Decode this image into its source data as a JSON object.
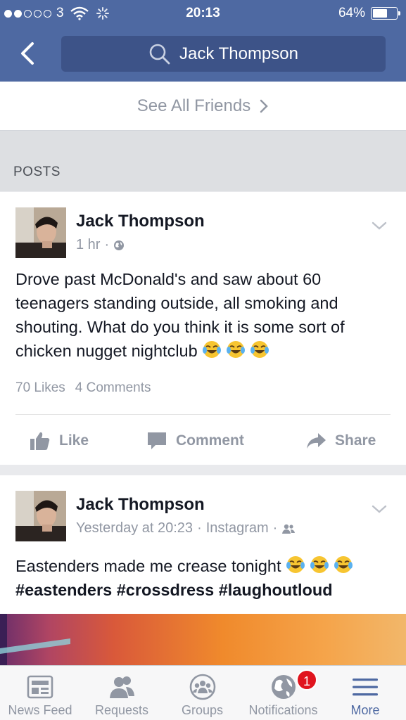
{
  "status_bar": {
    "carrier": "3",
    "time": "20:13",
    "battery": "64%",
    "battery_level": 0.64
  },
  "header": {
    "back_icon": "chevron-left-icon",
    "search_icon": "search-icon",
    "search_text": "Jack Thompson"
  },
  "friends": {
    "see_all_label": "See All Friends"
  },
  "posts_section": {
    "title": "POSTS"
  },
  "posts": [
    {
      "author": "Jack Thompson",
      "time": "1 hr",
      "audience_icon": "globe-icon",
      "text": "Drove past McDonald's and saw about 60 teenagers standing outside, all smoking and shouting. What do you think it is some sort of chicken nugget nightclub",
      "emojis": [
        "tears-of-joy-icon",
        "tears-of-joy-icon",
        "tears-of-joy-icon"
      ],
      "likes": "70 Likes",
      "comments": "4 Comments",
      "actions": {
        "like": "Like",
        "comment": "Comment",
        "share": "Share"
      }
    },
    {
      "author": "Jack Thompson",
      "time": "Yesterday at 20:23",
      "source": "Instagram",
      "audience_icon": "friends-icon",
      "text": "Eastenders made me crease tonight",
      "hashtags": "#eastenders #crossdress #laughoutloud",
      "emojis": [
        "tears-of-joy-icon",
        "tears-of-joy-icon",
        "tears-of-joy-icon"
      ]
    }
  ],
  "tabbar": {
    "news_feed": "News Feed",
    "requests": "Requests",
    "groups": "Groups",
    "notifications": "Notifications",
    "notifications_badge": "1",
    "more": "More"
  },
  "colors": {
    "brand": "#4e69a2",
    "badge": "#e0141e",
    "muted": "#9197a3"
  }
}
